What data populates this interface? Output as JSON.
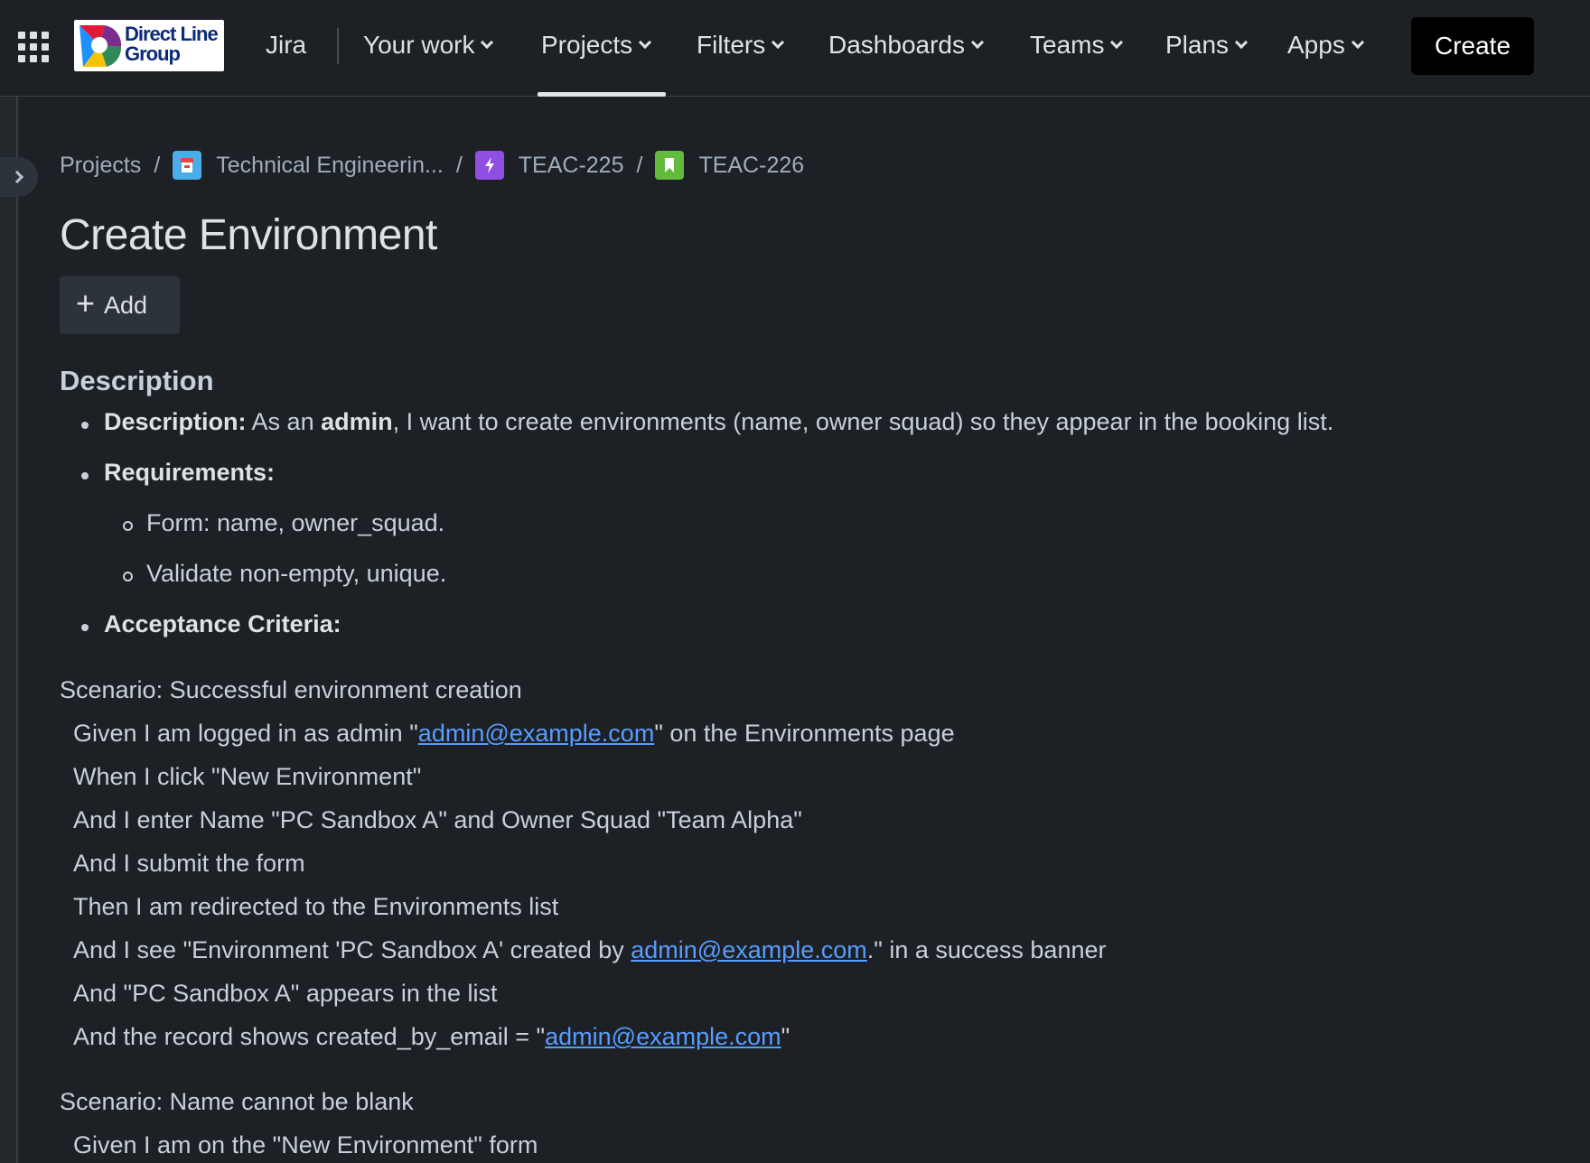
{
  "nav": {
    "jira": "Jira",
    "items": [
      {
        "label": "Your work"
      },
      {
        "label": "Projects"
      },
      {
        "label": "Filters"
      },
      {
        "label": "Dashboards"
      },
      {
        "label": "Teams"
      },
      {
        "label": "Plans"
      },
      {
        "label": "Apps"
      }
    ],
    "create": "Create",
    "logo_line1": "Direct Line",
    "logo_line2": "Group"
  },
  "breadcrumb": {
    "projects": "Projects",
    "project": "Technical Engineerin...",
    "epic": "TEAC-225",
    "story": "TEAC-226",
    "sep": "/"
  },
  "title": "Create Environment",
  "add_label": "Add",
  "description": {
    "heading": "Description",
    "b1_label": "Description:",
    "b1_pre": "As an",
    "b1_bold": "admin",
    "b1_post": ", I want to create environments (name, owner squad) so they appear in the booking list.",
    "b2_label": "Requirements:",
    "sub1": "Form: name, owner_squad.",
    "sub2": "Validate non-empty, unique.",
    "b3_label": "Acceptance Criteria:"
  },
  "scenario1": {
    "title": "Scenario: Successful environment creation",
    "l1_pre": "Given I am logged in as admin \"",
    "l1_link": "admin@example.com",
    "l1_post": "\" on the Environments page",
    "l2": "When I click \"New Environment\"",
    "l3": "And I enter Name \"PC Sandbox A\" and Owner Squad \"Team Alpha\"",
    "l4": "And I submit the form",
    "l5": "Then I am redirected to the Environments list",
    "l6_pre": "And I see \"Environment 'PC Sandbox A' created by ",
    "l6_link": "admin@example.com",
    "l6_post": ".\" in a success banner",
    "l7": "And \"PC Sandbox A\" appears in the list",
    "l8_pre": "And the record shows created_by_email = \"",
    "l8_link": "admin@example.com",
    "l8_post": "\""
  },
  "scenario2": {
    "title": "Scenario: Name cannot be blank",
    "l1": "Given I am on the \"New Environment\" form"
  }
}
